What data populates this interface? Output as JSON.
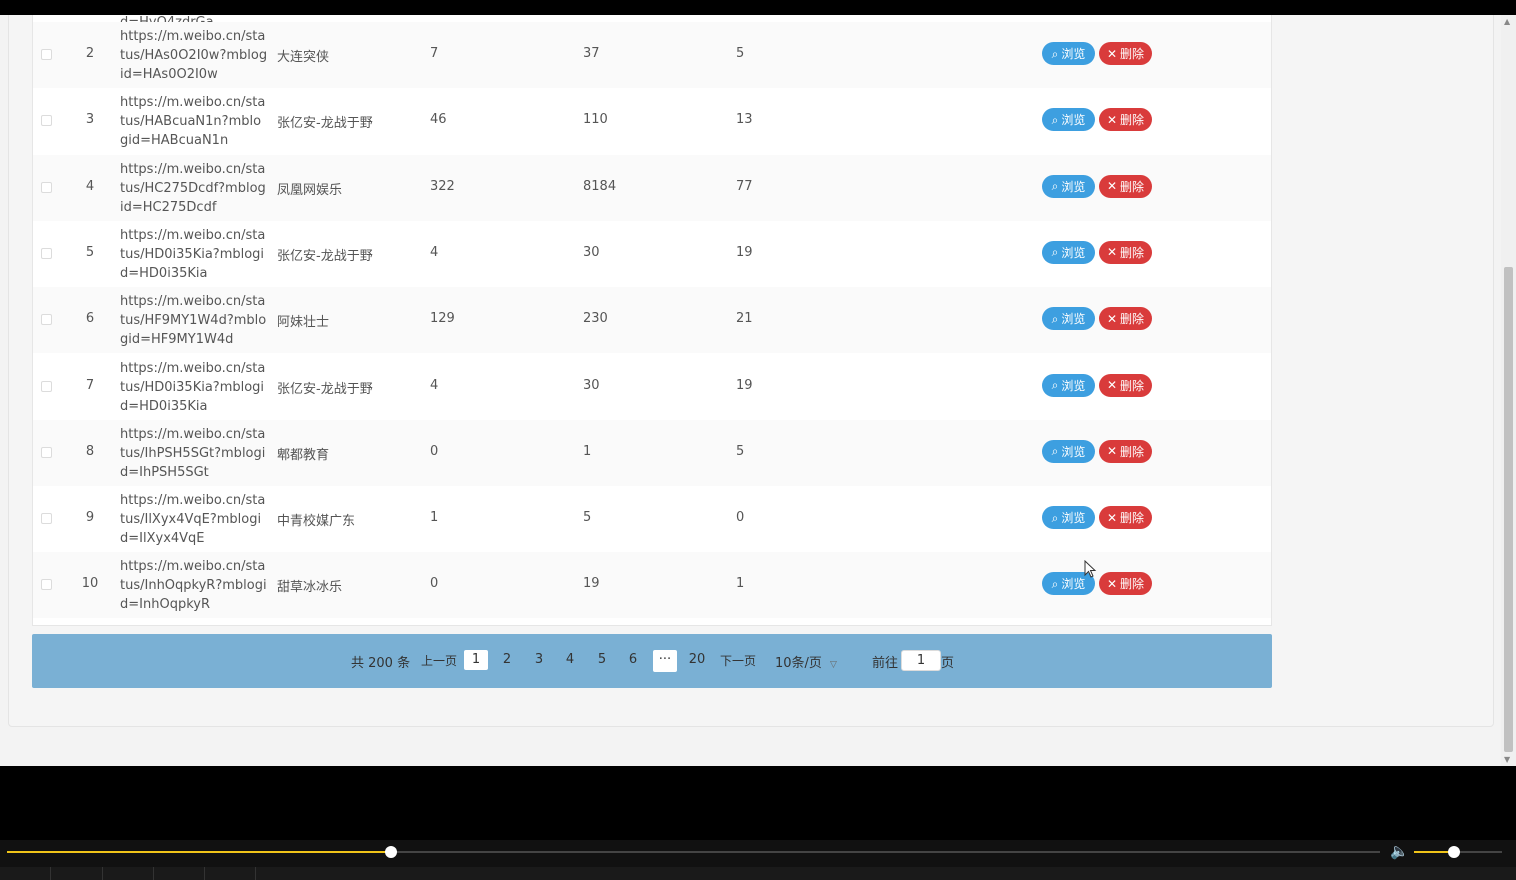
{
  "table": {
    "partial_top_row": {
      "url_tail": "d=HyQ4zdrGa"
    },
    "rows": [
      {
        "num": "2",
        "url": "https://m.weibo.cn/status/HAs0O2I0w?mblogid=HAs0O2I0w",
        "name": "大连突侠",
        "c1": "7",
        "c2": "37",
        "c3": "5"
      },
      {
        "num": "3",
        "url": "https://m.weibo.cn/status/HABcuaN1n?mblogid=HABcuaN1n",
        "name": "张亿安-龙战于野",
        "c1": "46",
        "c2": "110",
        "c3": "13"
      },
      {
        "num": "4",
        "url": "https://m.weibo.cn/status/HC275Dcdf?mblogid=HC275Dcdf",
        "name": "凤凰网娱乐",
        "c1": "322",
        "c2": "8184",
        "c3": "77"
      },
      {
        "num": "5",
        "url": "https://m.weibo.cn/status/HD0i35Kia?mblogid=HD0i35Kia",
        "name": "张亿安-龙战于野",
        "c1": "4",
        "c2": "30",
        "c3": "19"
      },
      {
        "num": "6",
        "url": "https://m.weibo.cn/status/HF9MY1W4d?mblogid=HF9MY1W4d",
        "name": "阿妹壮士",
        "c1": "129",
        "c2": "230",
        "c3": "21"
      },
      {
        "num": "7",
        "url": "https://m.weibo.cn/status/HD0i35Kia?mblogid=HD0i35Kia",
        "name": "张亿安-龙战于野",
        "c1": "4",
        "c2": "30",
        "c3": "19"
      },
      {
        "num": "8",
        "url": "https://m.weibo.cn/status/IhPSH5SGt?mblogid=IhPSH5SGt",
        "name": "郫都教育",
        "c1": "0",
        "c2": "1",
        "c3": "5"
      },
      {
        "num": "9",
        "url": "https://m.weibo.cn/status/IlXyx4VqE?mblogid=IlXyx4VqE",
        "name": "中青校媒广东",
        "c1": "1",
        "c2": "5",
        "c3": "0"
      },
      {
        "num": "10",
        "url": "https://m.weibo.cn/status/InhOqpkyR?mblogid=InhOqpkyR",
        "name": "甜草冰冰乐",
        "c1": "0",
        "c2": "19",
        "c3": "1"
      }
    ],
    "view_label": "浏览",
    "delete_label": "删除"
  },
  "pager": {
    "total": "共 200 条",
    "prev": "上一页",
    "pages": [
      "1",
      "2",
      "3",
      "4",
      "5",
      "6"
    ],
    "ellipsis": "···",
    "last": "20",
    "next": "下一页",
    "size": "10条/页",
    "goto": "前往",
    "goto_value": "1",
    "unit": "页"
  },
  "player": {
    "progress": 0.28,
    "volume": 0.45
  },
  "colors": {
    "view": "#3d9fe0",
    "delete": "#d93b3b",
    "pager_bg": "#7ab0d4",
    "accent": "#f0c419"
  }
}
